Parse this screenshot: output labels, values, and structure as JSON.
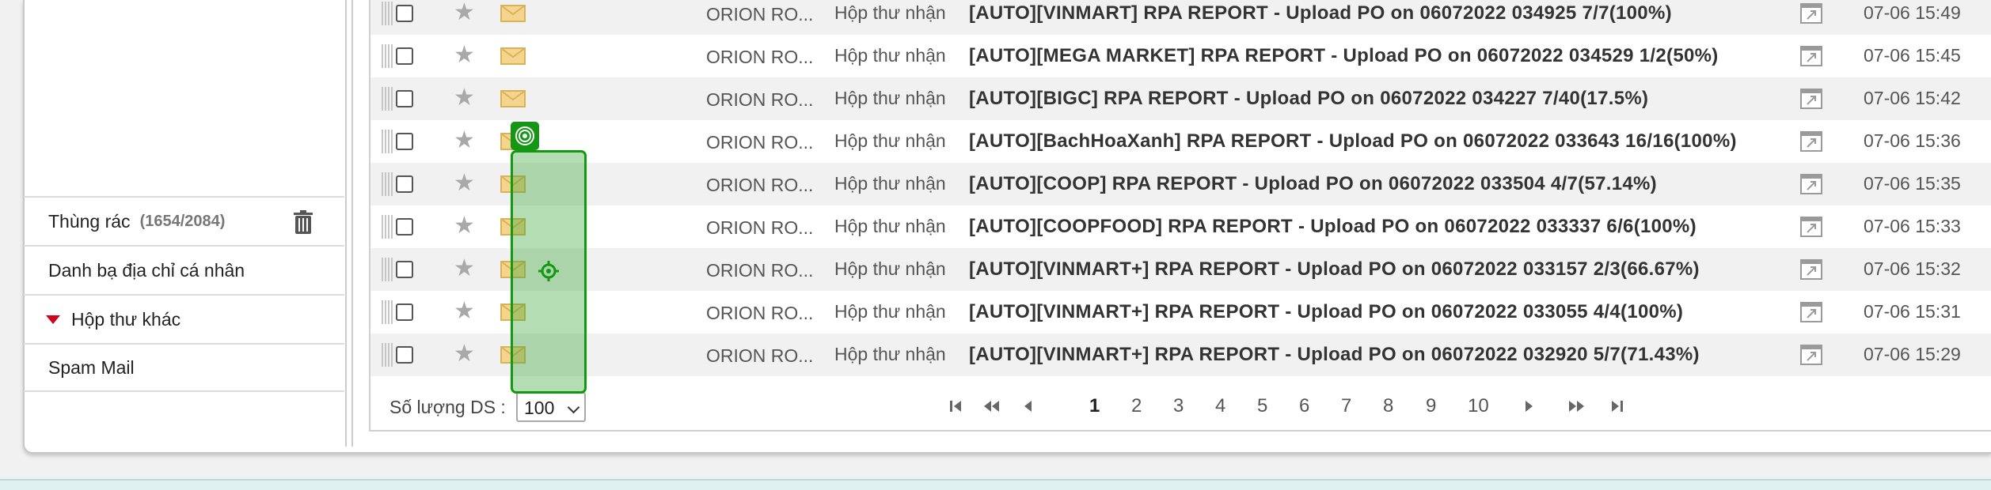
{
  "sidebar": {
    "items": [
      {
        "label": "Thùng rác",
        "count": "(1654/2084)",
        "icon": "trash-icon"
      },
      {
        "label": "Danh bạ địa chỉ cá nhân"
      },
      {
        "label": "Hộp thư khác",
        "icon": "caret-down-icon",
        "icon_color": "#d0021b"
      },
      {
        "label": "Spam Mail"
      }
    ]
  },
  "email_list": {
    "rows": [
      {
        "sender": "ORION RO...",
        "folder": "Hộp thư nhận",
        "subject": "[AUTO][VINMART] RPA REPORT - Upload PO on 06072022 034925 7/7(100%)",
        "date": "07-06 15:49"
      },
      {
        "sender": "ORION RO...",
        "folder": "Hộp thư nhận",
        "subject": "[AUTO][MEGA MARKET] RPA REPORT - Upload PO on 06072022 034529 1/2(50%)",
        "date": "07-06 15:45"
      },
      {
        "sender": "ORION RO...",
        "folder": "Hộp thư nhận",
        "subject": "[AUTO][BIGC] RPA REPORT - Upload PO on 06072022 034227 7/40(17.5%)",
        "date": "07-06 15:42"
      },
      {
        "sender": "ORION RO...",
        "folder": "Hộp thư nhận",
        "subject": "[AUTO][BachHoaXanh] RPA REPORT - Upload PO on 06072022 033643 16/16(100%)",
        "date": "07-06 15:36"
      },
      {
        "sender": "ORION RO...",
        "folder": "Hộp thư nhận",
        "subject": "[AUTO][COOP] RPA REPORT - Upload PO on 06072022 033504 4/7(57.14%)",
        "date": "07-06 15:35"
      },
      {
        "sender": "ORION RO...",
        "folder": "Hộp thư nhận",
        "subject": "[AUTO][COOPFOOD] RPA REPORT - Upload PO on 06072022 033337 6/6(100%)",
        "date": "07-06 15:33"
      },
      {
        "sender": "ORION RO...",
        "folder": "Hộp thư nhận",
        "subject": "[AUTO][VINMART+] RPA REPORT - Upload PO on 06072022 033157 2/3(66.67%)",
        "date": "07-06 15:32"
      },
      {
        "sender": "ORION RO...",
        "folder": "Hộp thư nhận",
        "subject": "[AUTO][VINMART+] RPA REPORT - Upload PO on 06072022 033055 4/4(100%)",
        "date": "07-06 15:31"
      },
      {
        "sender": "ORION RO...",
        "folder": "Hộp thư nhận",
        "subject": "[AUTO][VINMART+] RPA REPORT - Upload PO on 06072022 032920 5/7(71.43%)",
        "date": "07-06 15:29"
      }
    ]
  },
  "footer": {
    "page_size_label": "Số lượng DS :",
    "page_size_value": "100",
    "pages": [
      "1",
      "2",
      "3",
      "4",
      "5",
      "6",
      "7",
      "8",
      "9",
      "10"
    ],
    "current_page": "1",
    "nav_icons": [
      "first-page-icon",
      "prev-block-icon",
      "prev-page-icon",
      "next-page-icon",
      "next-block-icon",
      "last-page-icon"
    ]
  },
  "colors": {
    "highlight_green": "#119911",
    "odd_row": "#f1f1f1",
    "envelope": "#f5d58e"
  },
  "overlay": {
    "icons": [
      "target-badge-icon",
      "crosshair-icon"
    ]
  }
}
